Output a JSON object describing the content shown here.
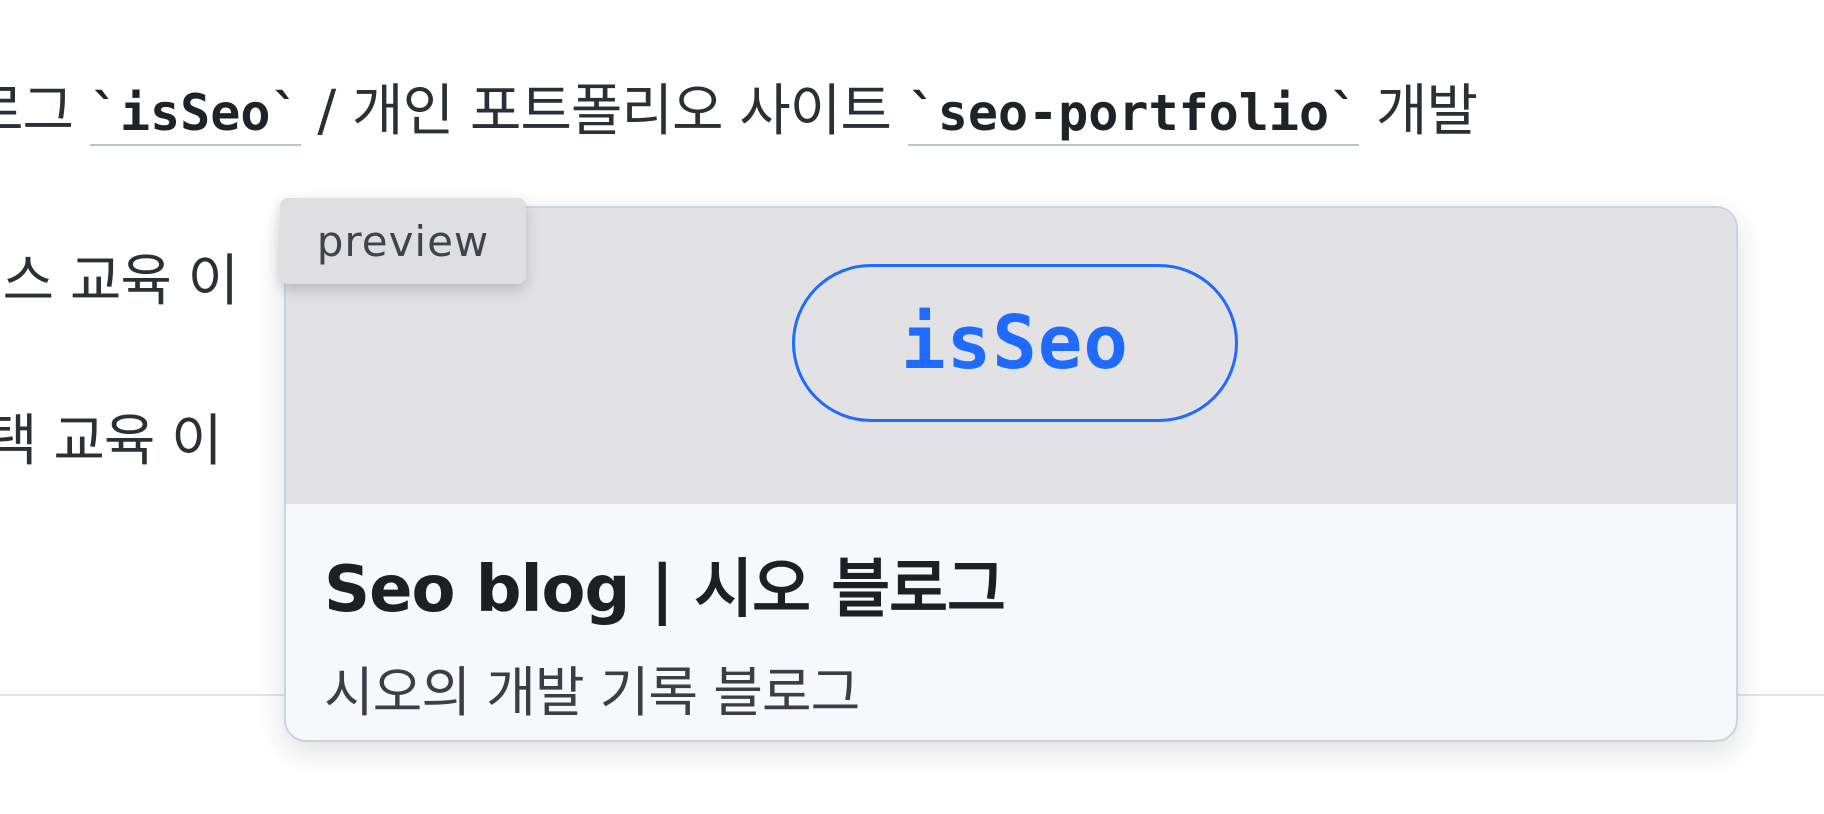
{
  "article": {
    "line1": {
      "prefix": "로그 ",
      "link1": "`isSeo`",
      "middle": " / 개인 포트폴리오 사이트 ",
      "link2": "`seo-portfolio`",
      "suffix": " 개발"
    },
    "line2": "런스 교육 이",
    "line3": "택 교육 이"
  },
  "preview": {
    "tag_label": "preview",
    "hero_text": "isSeo",
    "title": "Seo blog | 시오 블로그",
    "description": "시오의 개발 기록 블로그"
  },
  "colors": {
    "accent": "#1f6bff",
    "hero_bg": "#e2e2e4",
    "card_bg": "#f6f8fb",
    "card_border": "#c9d4e2"
  }
}
